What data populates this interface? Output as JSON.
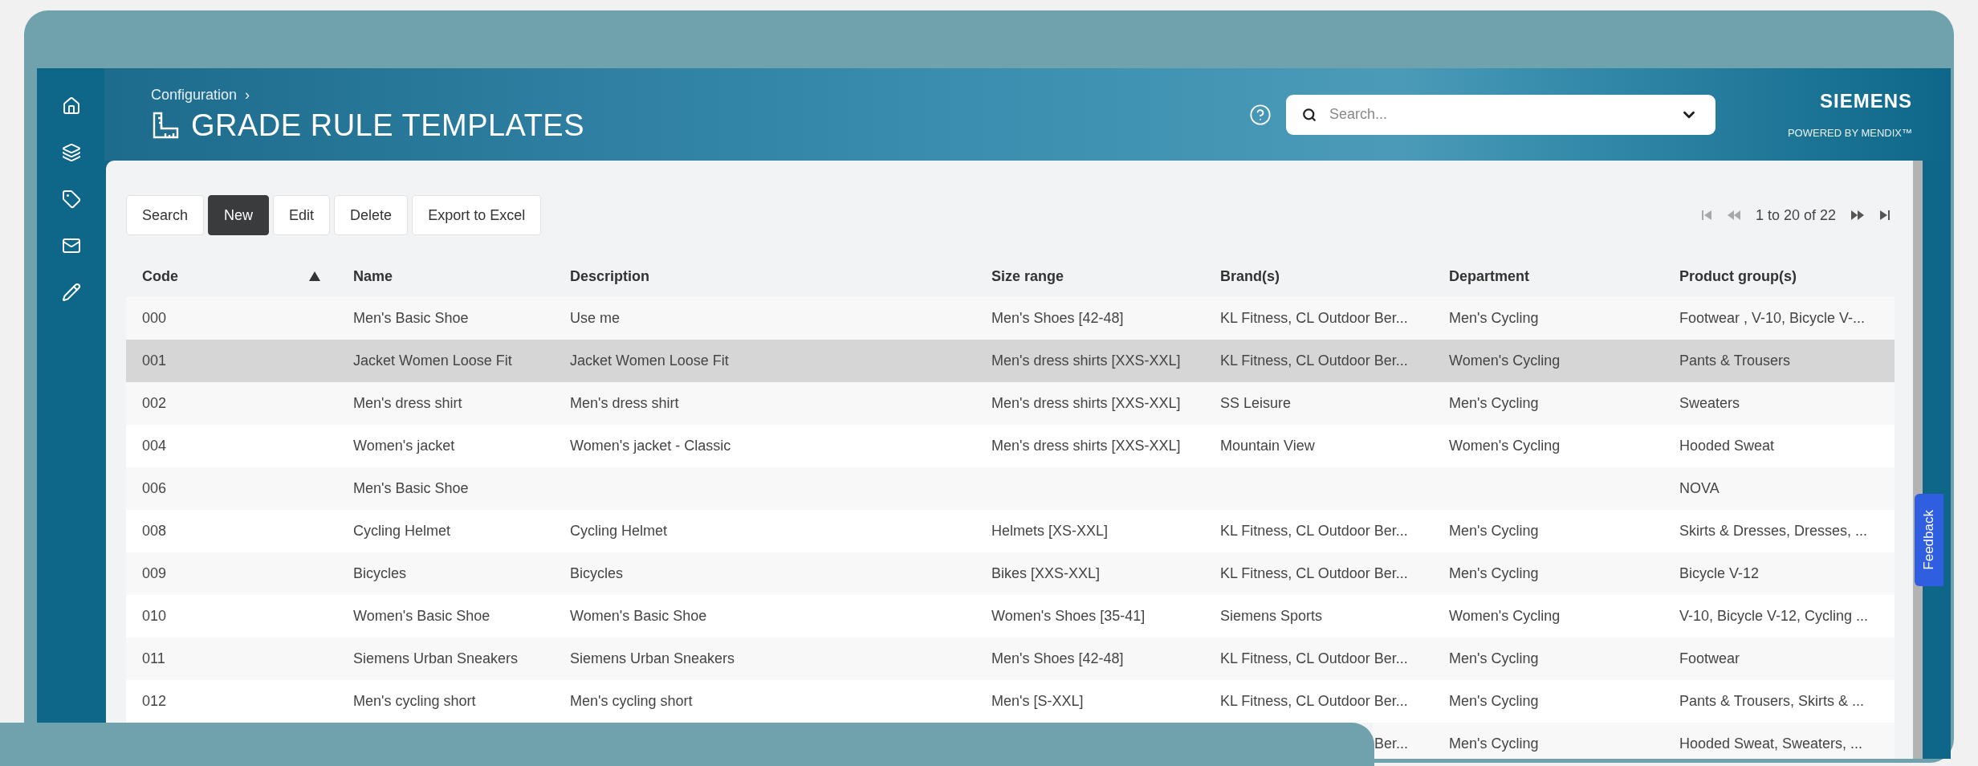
{
  "sidebar": {
    "items": [
      {
        "kind": "home"
      },
      {
        "kind": "layers"
      },
      {
        "kind": "tag"
      },
      {
        "kind": "mail"
      },
      {
        "kind": "pencil"
      }
    ]
  },
  "header": {
    "breadcrumb": "Configuration",
    "breadcrumb_separator": "›",
    "title": "GRADE RULE TEMPLATES",
    "search": {
      "placeholder": "Search..."
    },
    "brand": "SIEMENS",
    "tagline": "POWERED BY MENDIX™"
  },
  "toolbar": {
    "buttons": [
      {
        "label": "Search",
        "primary": false
      },
      {
        "label": "New",
        "primary": true
      },
      {
        "label": "Edit",
        "primary": false
      },
      {
        "label": "Delete",
        "primary": false
      },
      {
        "label": "Export to Excel",
        "primary": false
      }
    ]
  },
  "pagination": {
    "text": "1 to 20 of 22",
    "controls": [
      {
        "kind": "first",
        "disabled": true
      },
      {
        "kind": "previous",
        "disabled": true
      },
      {
        "kind": "next",
        "disabled": false
      },
      {
        "kind": "last",
        "disabled": false
      }
    ]
  },
  "table": {
    "columns": [
      {
        "label": "Code",
        "sorted": true
      },
      {
        "label": "Name",
        "sorted": false
      },
      {
        "label": "Description",
        "sorted": false
      },
      {
        "label": "Size range",
        "sorted": false
      },
      {
        "label": "Brand(s)",
        "sorted": false
      },
      {
        "label": "Department",
        "sorted": false
      },
      {
        "label": "Product group(s)",
        "sorted": false
      }
    ],
    "rows": [
      {
        "selected": false,
        "code": "000",
        "name": "Men's Basic Shoe",
        "description": "Use me",
        "size_range": "Men's Shoes [42-48]",
        "brands": "KL Fitness, CL Outdoor Ber...",
        "department": "Men's Cycling",
        "product_groups": "Footwear , V-10, Bicycle V-..."
      },
      {
        "selected": true,
        "code": "001",
        "name": "Jacket Women Loose Fit",
        "description": "Jacket Women Loose Fit",
        "size_range": "Men's dress shirts [XXS-XXL]",
        "brands": "KL Fitness, CL Outdoor Ber...",
        "department": "Women's Cycling",
        "product_groups": "Pants & Trousers"
      },
      {
        "selected": false,
        "code": "002",
        "name": "Men's dress shirt",
        "description": "Men's dress shirt",
        "size_range": "Men's dress shirts [XXS-XXL]",
        "brands": "SS Leisure",
        "department": "Men's Cycling",
        "product_groups": "Sweaters"
      },
      {
        "selected": false,
        "code": "004",
        "name": "Women's jacket",
        "description": "Women's jacket - Classic",
        "size_range": "Men's dress shirts [XXS-XXL]",
        "brands": "Mountain View",
        "department": "Women's Cycling",
        "product_groups": "Hooded Sweat"
      },
      {
        "selected": false,
        "code": "006",
        "name": "Men's Basic Shoe",
        "product_groups": "NOVA"
      },
      {
        "selected": false,
        "code": "008",
        "name": "Cycling Helmet",
        "description": "Cycling Helmet",
        "size_range": "Helmets [XS-XXL]",
        "brands": "KL Fitness, CL Outdoor Ber...",
        "department": "Men's Cycling",
        "product_groups": "Skirts & Dresses, Dresses, ..."
      },
      {
        "selected": false,
        "code": "009",
        "name": "Bicycles",
        "description": "Bicycles",
        "size_range": "Bikes [XXS-XXL]",
        "brands": "KL Fitness, CL Outdoor Ber...",
        "department": "Men's Cycling",
        "product_groups": "Bicycle V-12"
      },
      {
        "selected": false,
        "code": "010",
        "name": "Women's Basic Shoe",
        "description": "Women's Basic Shoe",
        "size_range": "Women's Shoes [35-41]",
        "brands": "Siemens Sports",
        "department": "Women's Cycling",
        "product_groups": "V-10, Bicycle V-12, Cycling ..."
      },
      {
        "selected": false,
        "code": "011",
        "name": "Siemens Urban Sneakers",
        "description": "Siemens Urban Sneakers",
        "size_range": "Men's Shoes [42-48]",
        "brands": "KL Fitness, CL Outdoor Ber...",
        "department": "Men's Cycling",
        "product_groups": "Footwear"
      },
      {
        "selected": false,
        "code": "012",
        "name": "Men's cycling short",
        "description": "Men's cycling short",
        "size_range": "Men's [S-XXL]",
        "brands": "KL Fitness, CL Outdoor Ber...",
        "department": "Men's Cycling",
        "product_groups": "Pants & Trousers, Skirts & ..."
      },
      {
        "selected": false,
        "covered": true,
        "brands": "Ber...",
        "department": "Men's Cycling",
        "product_groups": "Hooded Sweat, Sweaters, ..."
      }
    ]
  },
  "feedback": {
    "label": "Feedback"
  }
}
